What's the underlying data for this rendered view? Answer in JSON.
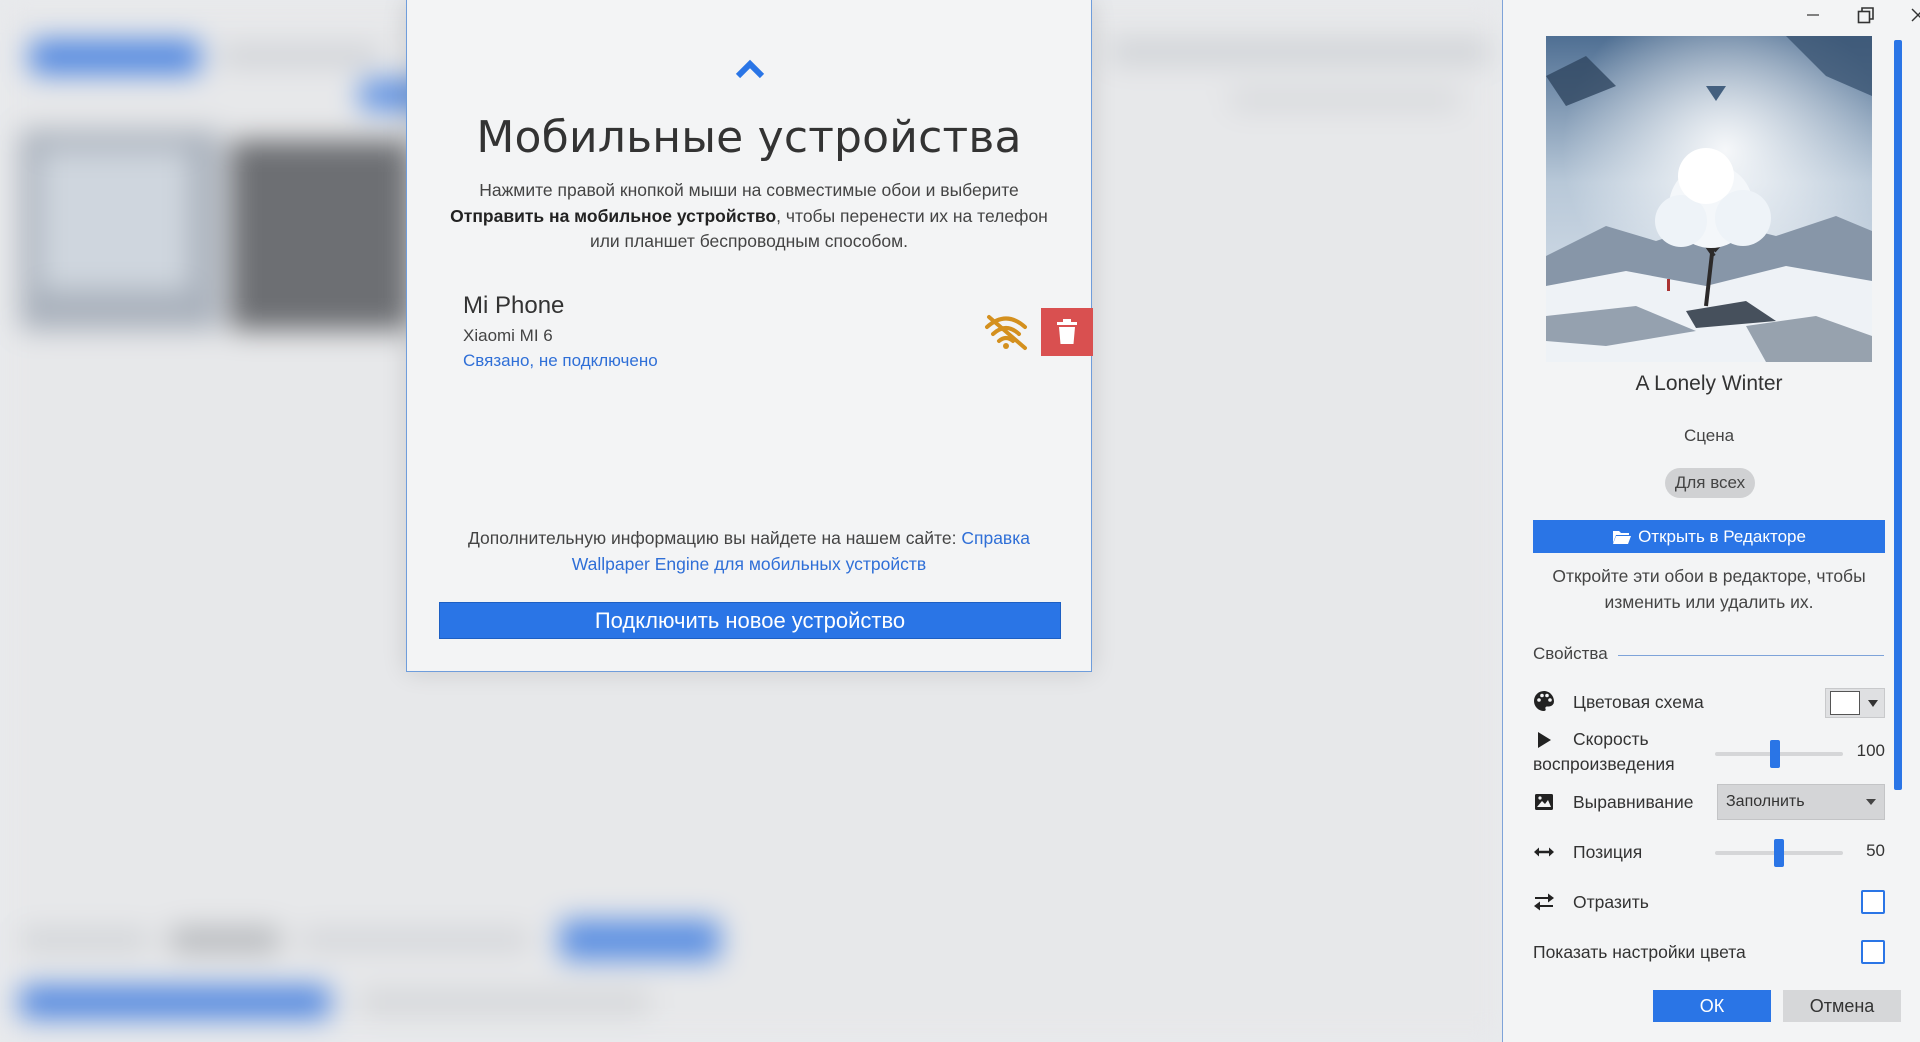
{
  "modal": {
    "title": "Мобильные устройства",
    "desc_line1": "Нажмите правой кнопкой мыши на совместимые обои и выберите",
    "desc_bold": "Отправить на мобильное устройство",
    "desc_line2_rest": ", чтобы перенести их на телефон",
    "desc_line3": "или планшет беспроводным способом.",
    "device": {
      "name": "Mi Phone",
      "model": "Xiaomi MI 6",
      "status": "Связано, не подключено"
    },
    "info_text": "Дополнительную информацию вы найдете на нашем сайте: ",
    "info_link": "Справка Wallpaper Engine для мобильных устройств",
    "connect_button": "Подключить новое устройство"
  },
  "panel": {
    "wallpaper_title": "A Lonely Winter",
    "wallpaper_type": "Сцена",
    "rating_badge": "Для всех",
    "open_editor_button": "Открыть в Редакторе",
    "editor_note": "Откройте эти обои в редакторе, чтобы изменить или удалить их.",
    "properties_title": "Свойства",
    "properties": {
      "color_scheme": {
        "label": "Цветовая схема",
        "value": "#ffffff"
      },
      "playback_speed": {
        "label": "Скорость воспроизведения",
        "value": "100",
        "fraction": 0.47
      },
      "alignment": {
        "label": "Выравнивание",
        "value": "Заполнить"
      },
      "position": {
        "label": "Позиция",
        "value": "50",
        "fraction": 0.5
      },
      "mirror": {
        "label": "Отразить",
        "checked": false
      },
      "show_color_settings": {
        "label": "Показать настройки цвета",
        "checked": false
      }
    },
    "ok_button": "ОК",
    "cancel_button": "Отмена"
  },
  "colors": {
    "accent": "#2a75e6",
    "delete": "#d95050",
    "warning_icon": "#d4901e",
    "link": "#2f6fd7"
  }
}
